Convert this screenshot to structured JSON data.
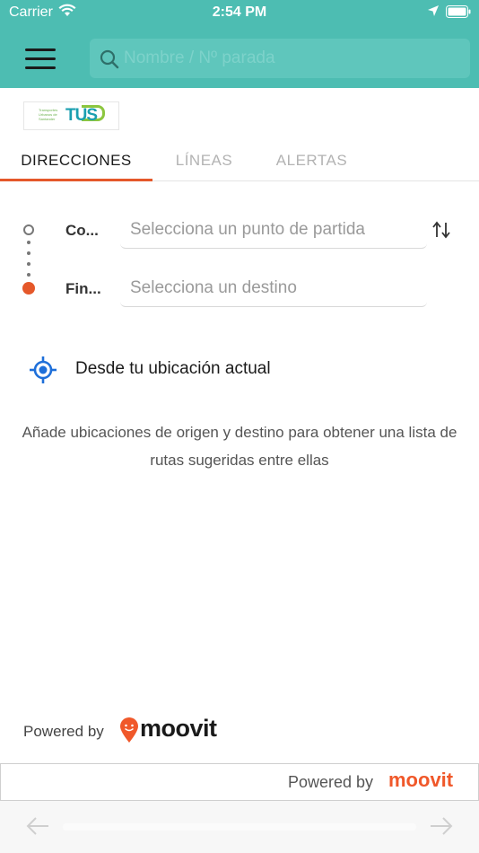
{
  "status_bar": {
    "carrier": "Carrier",
    "time": "2:54 PM",
    "icons": [
      "wifi-icon",
      "location-arrow-icon",
      "battery-icon"
    ]
  },
  "header": {
    "menu_icon": "hamburger-menu-icon",
    "search": {
      "icon": "search-icon",
      "placeholder": "Nombre / Nº parada"
    }
  },
  "brand": {
    "logo_small_text": "Transportes Urbanos de Santander",
    "logo_word": "TUS"
  },
  "tabs": [
    {
      "label": "DIRECCIONES",
      "active": true
    },
    {
      "label": "LÍNEAS",
      "active": false
    },
    {
      "label": "ALERTAS",
      "active": false
    }
  ],
  "route": {
    "start_label": "Co...",
    "start_placeholder": "Selecciona un punto de partida",
    "end_label": "Fin...",
    "end_placeholder": "Selecciona un destino",
    "swap_icon": "swap-vertical-icon"
  },
  "current_location": {
    "icon": "crosshair-location-icon",
    "label": "Desde tu ubicación actual"
  },
  "hint_text": "Añade ubicaciones de origen y destino para obtener una lista de rutas sugeridas entre ellas",
  "powered_main": {
    "prefix": "Powered by",
    "brand": "moovit"
  },
  "powered_bar": {
    "prefix": "Powered by",
    "brand": "moovit"
  },
  "browser_nav": {
    "back_icon": "arrow-left-icon",
    "forward_icon": "arrow-right-icon"
  },
  "colors": {
    "header": "#4dbdb2",
    "accent": "#e5582a",
    "location_blue": "#1e6fd9",
    "moovit_orange": "#f0582a"
  }
}
